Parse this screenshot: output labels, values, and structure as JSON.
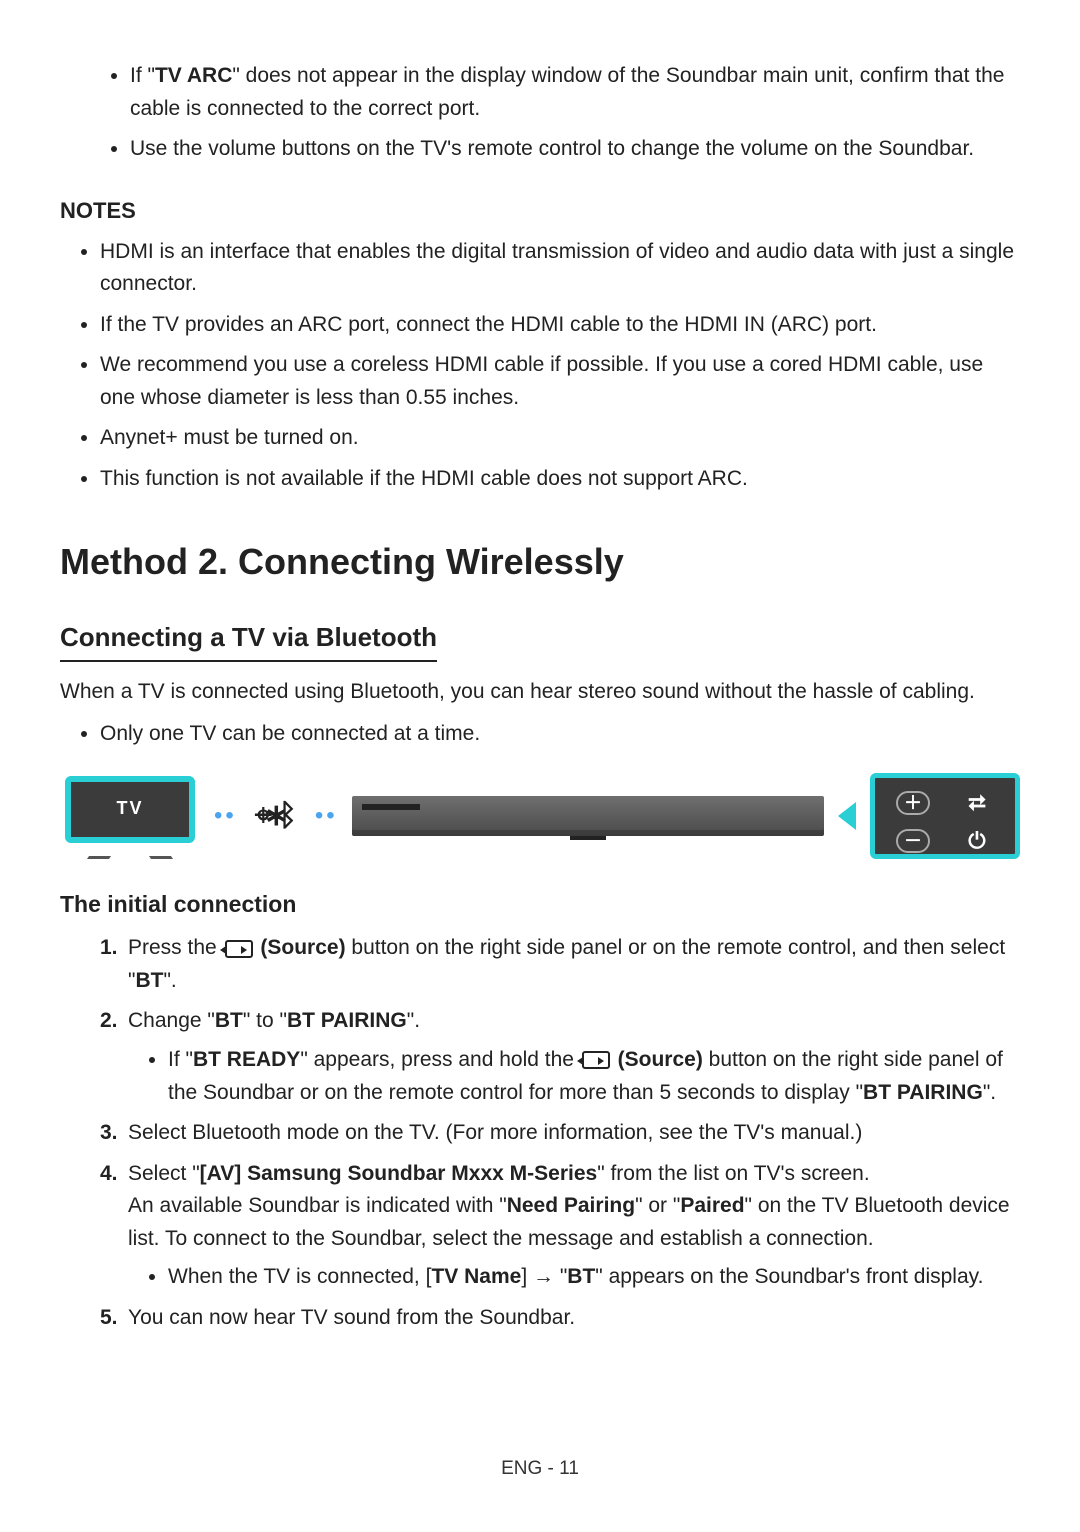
{
  "intro_bullets": [
    {
      "pre": "If \"",
      "bold": "TV ARC",
      "post": "\" does not appear in the display window of the Soundbar main unit, confirm that the cable is connected to the correct port."
    },
    {
      "pre": "",
      "bold": "",
      "post": "Use the volume buttons on the TV's remote control to change the volume on the Soundbar."
    }
  ],
  "notes": {
    "heading": "NOTES",
    "items": [
      "HDMI is an interface that enables the digital transmission of video and audio data with just a single connector.",
      "If the TV provides an ARC port, connect the HDMI cable to the HDMI IN (ARC) port.",
      "We recommend you use a coreless HDMI cable if possible. If you use a cored HDMI cable, use one whose diameter is less than 0.55 inches.",
      "Anynet+ must be turned on.",
      "This function is not available if the HDMI cable does not support ARC."
    ]
  },
  "method2": {
    "title": "Method 2. Connecting Wirelessly",
    "bt_heading": "Connecting a TV via Bluetooth",
    "bt_desc": "When a TV is connected using Bluetooth, you can hear stereo sound without the hassle of cabling.",
    "bt_bullets": [
      "Only one TV can be connected at a time."
    ],
    "tv_label": "TV"
  },
  "initial": {
    "heading": "The initial connection",
    "step1": {
      "pre": "Press the ",
      "sourceLabel": " (Source)",
      "post1": " button on the right side panel or on the remote control, and then select \"",
      "bt": "BT",
      "post2": "\"."
    },
    "step2": {
      "pre": "Change \"",
      "bt": "BT",
      "mid": "\" to \"",
      "pairing": "BT PAIRING",
      "post": "\".",
      "sub_pre": "If \"",
      "ready": "BT READY",
      "sub_mid1": "\" appears, press and hold the ",
      "sourceLabel": " (Source)",
      "sub_mid2": " button on the right side panel of the Soundbar or on the remote control for more than 5 seconds to display \"",
      "pairing2": "BT PAIRING",
      "sub_post": "\"."
    },
    "step3": "Select Bluetooth mode on the TV. (For more information, see the TV's manual.)",
    "step4": {
      "pre": "Select \"",
      "av": "[AV] Samsung Soundbar Mxxx M-Series",
      "post": "\" from the list on TV's screen.",
      "line2_pre": "An available Soundbar is indicated with \"",
      "need": "Need Pairing",
      "line2_mid": "\" or \"",
      "paired": "Paired",
      "line2_post": "\" on the TV Bluetooth device list. To connect to the Soundbar, select the message and establish a connection.",
      "sub_pre": "When the TV is connected, [",
      "tvname": "TV Name",
      "sub_mid": "] → \"",
      "bt": "BT",
      "sub_post": "\" appears on the Soundbar's front display."
    },
    "step5": "You can now hear TV sound from the Soundbar."
  },
  "footer": "ENG - 11"
}
